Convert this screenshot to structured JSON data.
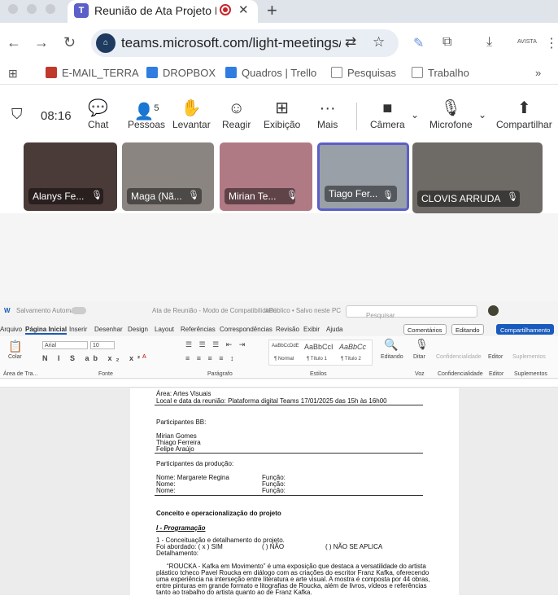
{
  "browser": {
    "tab_title": "Reunião de Ata Projeto RC",
    "new_tab": "+",
    "url": "teams.microsoft.com/light-meetings/l...",
    "bookmarks": [
      "E-MAIL_TERRA",
      "DROPBOX",
      "Quadros | Trello",
      "Pesquisas",
      "Trabalho"
    ],
    "ext_text": "AVISTA"
  },
  "toolbar": {
    "time": "08:16",
    "chat": "Chat",
    "people": "Pessoas",
    "people_count": "5",
    "raise": "Levantar",
    "react": "Reagir",
    "view": "Exibição",
    "more": "Mais",
    "camera": "Câmera",
    "mic": "Microfone",
    "share": "Compartilhar"
  },
  "participants": [
    {
      "name": "Alanys Fe...",
      "bg": "#4a3a38"
    },
    {
      "name": "Maga (Nã...",
      "bg": "#8a8580"
    },
    {
      "name": "Mirian Te...",
      "bg": "#b07a85"
    },
    {
      "name": "Tiago Fer...",
      "bg": "#9aa0a8"
    },
    {
      "name": "CLOVIS ARRUDA",
      "bg": "#6e6a66"
    }
  ],
  "word": {
    "autosave": "Salvamento Automático",
    "doc_title": "Ata de Reunião - Modo de Compatibilidade",
    "sensitivity": "#Público • Salvo neste PC",
    "search": "Pesquisar",
    "menus": [
      "Arquivo",
      "Página Inicial",
      "Inserir",
      "Desenhar",
      "Design",
      "Layout",
      "Referências",
      "Correspondências",
      "Revisão",
      "Exibir",
      "Ajuda"
    ],
    "comments": "Comentários",
    "editing": "Editando",
    "share": "Compartilhamento",
    "font": "Arial",
    "size": "10",
    "paste": "Colar",
    "styles": [
      "AaBbCcDdE",
      "AaBbCcI",
      "AaBbCc"
    ],
    "style_names": [
      "¶ Normal",
      "¶ Título 1",
      "¶ Título 2"
    ],
    "groups": [
      "Área de Tra...",
      "Fonte",
      "Parágrafo",
      "Estilos",
      "Voz",
      "Confidencialidade",
      "Editor",
      "Suplementos"
    ],
    "editing_btn": "Editando",
    "dictate": "Ditar",
    "confid": "Confidencialidade",
    "editor": "Editor",
    "addins": "Suplementos"
  },
  "doc": {
    "area": "Área: Artes Visuais",
    "local": "Local e data da reunião: Plataforma digital Teams 17/01/2025 das 15h às 16h00",
    "bb_title": "Participantes BB:",
    "bb": [
      "Mirian Gomes",
      "Thiago Ferreira",
      "Felipe Araújo"
    ],
    "prod_title": "Participantes da produção:",
    "prod": [
      {
        "name": "Nome:  Margarete Regina",
        "role": "Função:"
      },
      {
        "name": "Nome:",
        "role": "Função:"
      },
      {
        "name": "Nome:",
        "role": "Função:"
      }
    ],
    "section": "Conceito e operacionalização do projeto",
    "prog": "I - Programação",
    "item1": "1 - Conceituação e detalhamento do projeto.",
    "foi": "Foi abordado:  ( x ) SIM",
    "nao": "(   ) NÃO",
    "naoaplica": "(   ) NÃO SE APLICA",
    "detal": "Detalhamento:",
    "p1": "“ROUCKA - Kafka em Movimento” é uma exposição que destaca a versatilidade do artista",
    "p2": "plástico tcheco Pavel Roucka em diálogo com as criações do escritor Franz Kafka, oferecendo",
    "p3": "uma experiência na interseção entre literatura e arte visual. A mostra é composta por 44 obras,",
    "p4": "entre pinturas em grande formato e litografias de Roucka, além de livros, vídeos e referências",
    "p5": "tanto ao trabalho do artista quanto ao de Franz Kafka."
  }
}
